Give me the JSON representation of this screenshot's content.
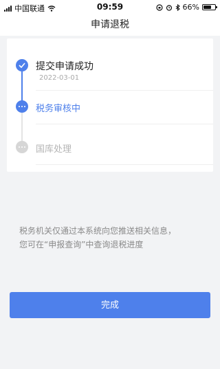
{
  "status_bar": {
    "carrier": "中国联通",
    "time": "09:59",
    "battery": "66%",
    "battery_level": 0.66
  },
  "nav": {
    "title": "申请退税"
  },
  "steps": [
    {
      "label": "提交申请成功",
      "date": "2022-03-01",
      "state": "done"
    },
    {
      "label": "税务审核中",
      "state": "active"
    },
    {
      "label": "国库处理",
      "state": "pending"
    }
  ],
  "info": {
    "line1": "税务机关仅通过本系统向您推送相关信息，",
    "line2": "您可在“申报查询”中查询退税进度"
  },
  "buttons": {
    "done": "完成"
  },
  "colors": {
    "accent": "#4e80eb",
    "pending": "#d6d6d6",
    "background": "#f2f3f5"
  }
}
